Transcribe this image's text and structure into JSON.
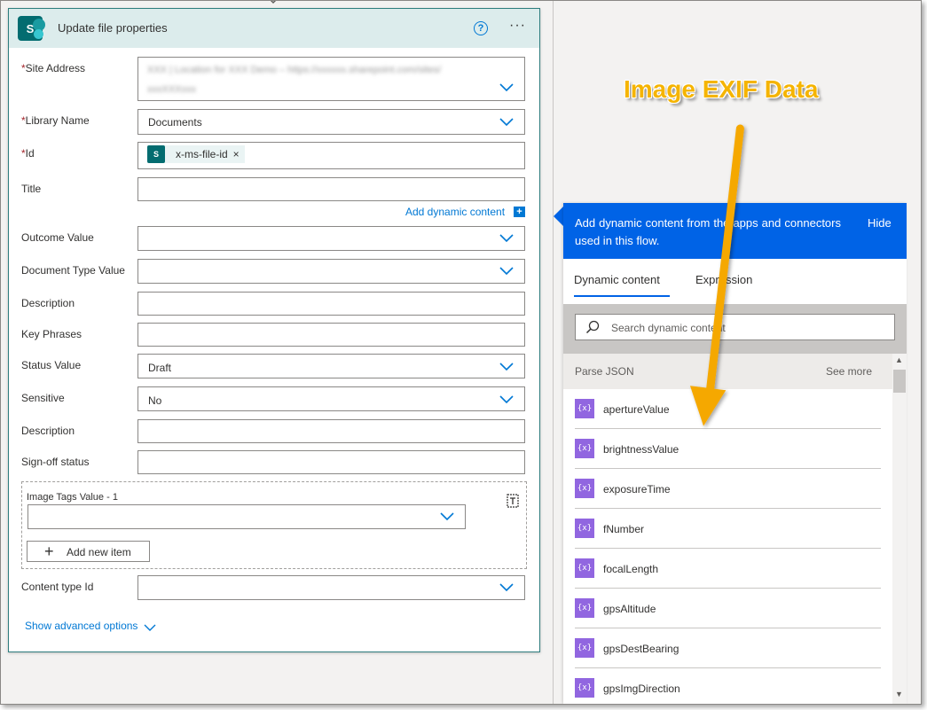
{
  "card": {
    "title": "Update file properties",
    "help": "?",
    "more": "···",
    "fields": [
      {
        "label": "Site Address",
        "required": true
      },
      {
        "label": "Library Name",
        "required": true,
        "value": "Documents"
      },
      {
        "label": "Id",
        "required": true,
        "token": "x-ms-file-id",
        "token_remove": "×"
      },
      {
        "label": "Title"
      },
      {
        "label": "Outcome Value"
      },
      {
        "label": "Document Type Value"
      },
      {
        "label": "Description"
      },
      {
        "label": "Key Phrases"
      },
      {
        "label": "Status Value",
        "value": "Draft"
      },
      {
        "label": "Sensitive",
        "value": "No"
      },
      {
        "label": "Description"
      },
      {
        "label": "Sign-off status"
      },
      {
        "label": "Content type Id"
      }
    ],
    "site_address_blurred": [
      "XXX | Location for XXX Demo – https://xxxxxx.sharepoint.com/sites/",
      "xxxXXXxxx"
    ],
    "add_dynamic_content": "Add dynamic content",
    "add_dynamic_plus": "+",
    "array": {
      "label": "Image Tags Value - 1",
      "add_button": "Add new item",
      "add_plus": "+"
    },
    "show_advanced": "Show advanced options"
  },
  "dynamic_pane": {
    "header": "Add dynamic content from the apps and connectors used in this flow.",
    "hide": "Hide",
    "tabs": [
      "Dynamic content",
      "Expression"
    ],
    "search_placeholder": "Search dynamic content",
    "group": {
      "name": "Parse JSON",
      "see_more": "See more"
    },
    "icon_glyph": "{x}",
    "items": [
      "apertureValue",
      "brightnessValue",
      "exposureTime",
      "fNumber",
      "focalLength",
      "gpsAltitude",
      "gpsDestBearing",
      "gpsImgDirection"
    ],
    "accent_color": "#0063e6",
    "item_icon_color": "#9166e0"
  },
  "annotation": {
    "text": "Image EXIF Data",
    "color": "#f5b400"
  }
}
